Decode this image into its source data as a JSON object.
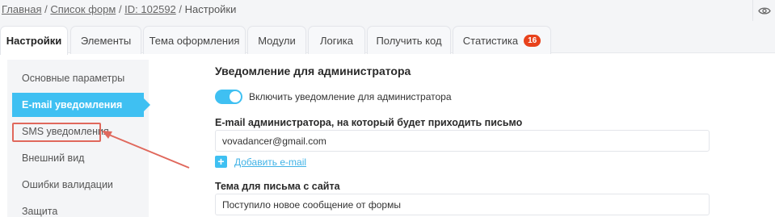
{
  "breadcrumb": {
    "items": [
      "Главная",
      "Список форм",
      "ID: 102592",
      "Настройки"
    ]
  },
  "tabs": [
    {
      "label": "Настройки",
      "active": true
    },
    {
      "label": "Элементы"
    },
    {
      "label": "Тема оформления"
    },
    {
      "label": "Модули"
    },
    {
      "label": "Логика"
    },
    {
      "label": "Получить код"
    },
    {
      "label": "Статистика",
      "badge": "16"
    }
  ],
  "sidebar": {
    "items": [
      {
        "label": "Основные параметры"
      },
      {
        "label": "E-mail уведомления",
        "active": true
      },
      {
        "label": "SMS уведомления",
        "highlighted": true
      },
      {
        "label": "Внешний вид"
      },
      {
        "label": "Ошибки валидации"
      },
      {
        "label": "Защита"
      }
    ]
  },
  "main": {
    "section_title": "Уведомление для администратора",
    "toggle": {
      "label": "Включить уведомление для администратора",
      "on": true
    },
    "admin_email": {
      "label": "E-mail администратора, на который будет приходить письмо",
      "value": "vovadancer@gmail.com"
    },
    "add_email_label": "Добавить e-mail",
    "subject": {
      "label": "Тема для письма с сайта",
      "value": "Поступило новое сообщение от формы"
    }
  },
  "colors": {
    "accent": "#3fc0f2",
    "badge": "#e8421c",
    "annotation": "#e0685c"
  },
  "icons": {
    "visibility": "eye-icon",
    "add": "plus-icon"
  }
}
